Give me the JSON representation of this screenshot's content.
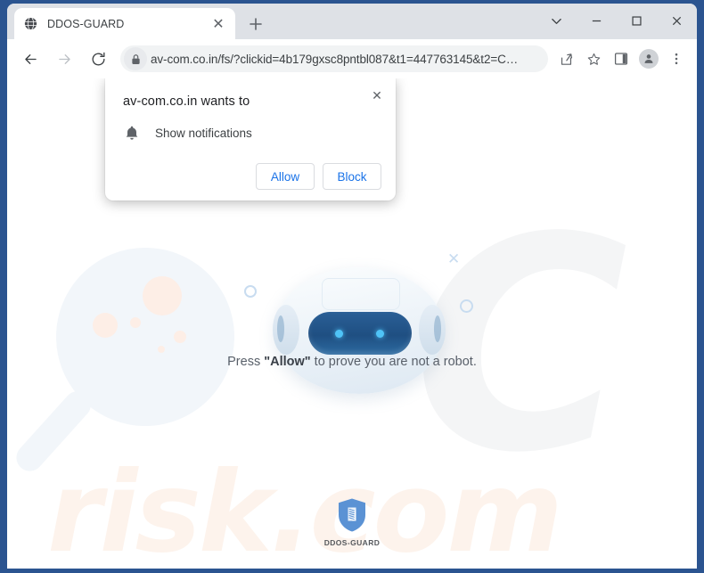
{
  "window": {
    "controls": [
      {
        "name": "tab-search",
        "glyph": "⌄"
      },
      {
        "name": "minimize",
        "glyph": "—"
      },
      {
        "name": "maximize",
        "glyph": "□"
      },
      {
        "name": "close",
        "glyph": "✕"
      }
    ]
  },
  "tab": {
    "title": "DDOS-GUARD",
    "favicon": "globe-icon",
    "close_glyph": "✕",
    "newtab_glyph": "+"
  },
  "toolbar": {
    "back_icon": "back-arrow-icon",
    "forward_icon": "forward-arrow-icon",
    "reload_icon": "reload-icon",
    "lock_icon": "lock-icon",
    "url": "av-com.co.in/fs/?clickid=4b179gxsc8pntbl087&t1=447763145&t2=C…",
    "share_icon": "share-icon",
    "bookmark_icon": "star-icon",
    "sidepanel_icon": "side-panel-icon",
    "profile_icon": "profile-avatar-icon",
    "menu_icon": "three-dot-menu-icon"
  },
  "dialog": {
    "title": "av-com.co.in wants to",
    "permission_label": "Show notifications",
    "permission_icon": "bell-icon",
    "close_glyph": "✕",
    "allow_label": "Allow",
    "block_label": "Block",
    "accent_color": "#1a73e8"
  },
  "page": {
    "hint_prefix": "Press ",
    "hint_strong": "\"Allow\"",
    "hint_suffix": " to prove you are not a robot.",
    "watermark_text": "risk.com",
    "watermark_letter": "C",
    "footer_label": "DDOS-GUARD",
    "footer_icon": "shield-icon",
    "shield_color": "#5b92d4"
  }
}
